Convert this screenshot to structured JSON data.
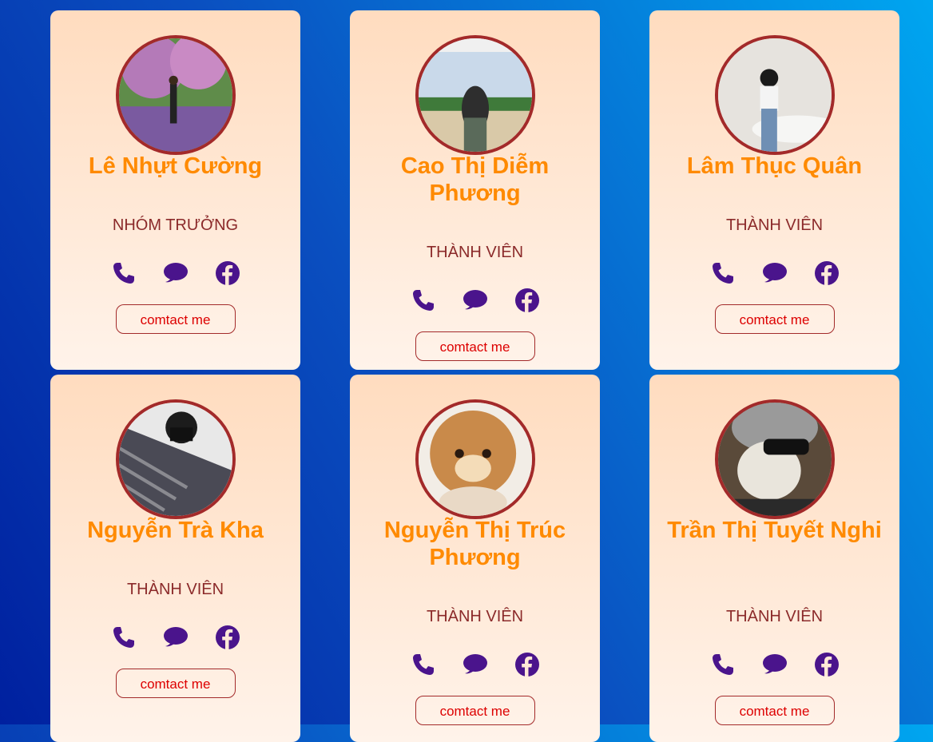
{
  "colors": {
    "name": "#ff8a00",
    "role": "#8b2a2a",
    "icon": "#4a148c",
    "button_text": "#dd0000",
    "avatar_border": "#a32a2a"
  },
  "icons": [
    "phone-icon",
    "message-icon",
    "facebook-icon"
  ],
  "members": [
    {
      "name": "Lê Nhựt Cường",
      "role": "NHÓM TRƯỞNG",
      "button": "comtact me"
    },
    {
      "name": "Cao Thị Diễm Phương",
      "role": "THÀNH VIÊN",
      "button": "comtact me"
    },
    {
      "name": "Lâm Thục Quân",
      "role": "THÀNH VIÊN",
      "button": "comtact me"
    },
    {
      "name": "Nguyễn Trà Kha",
      "role": "THÀNH VIÊN",
      "button": "comtact me"
    },
    {
      "name": "Nguyễn Thị Trúc Phương",
      "role": "THÀNH VIÊN",
      "button": "comtact me"
    },
    {
      "name": "Trần Thị Tuyết Nghi",
      "role": "THÀNH VIÊN",
      "button": "comtact me"
    }
  ]
}
